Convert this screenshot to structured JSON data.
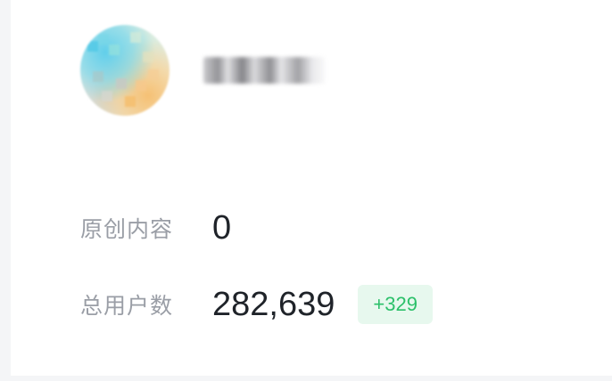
{
  "profile": {
    "avatar_icon": "avatar-image-blurred",
    "username": ""
  },
  "stats": [
    {
      "label": "原创内容",
      "value": "0"
    },
    {
      "label": "总用户数",
      "value": "282,639",
      "delta": "+329"
    }
  ],
  "colors": {
    "label": "#9a9ea6",
    "value": "#1f2329",
    "delta_text": "#2cc06a",
    "delta_bg": "#e7f8ee"
  }
}
